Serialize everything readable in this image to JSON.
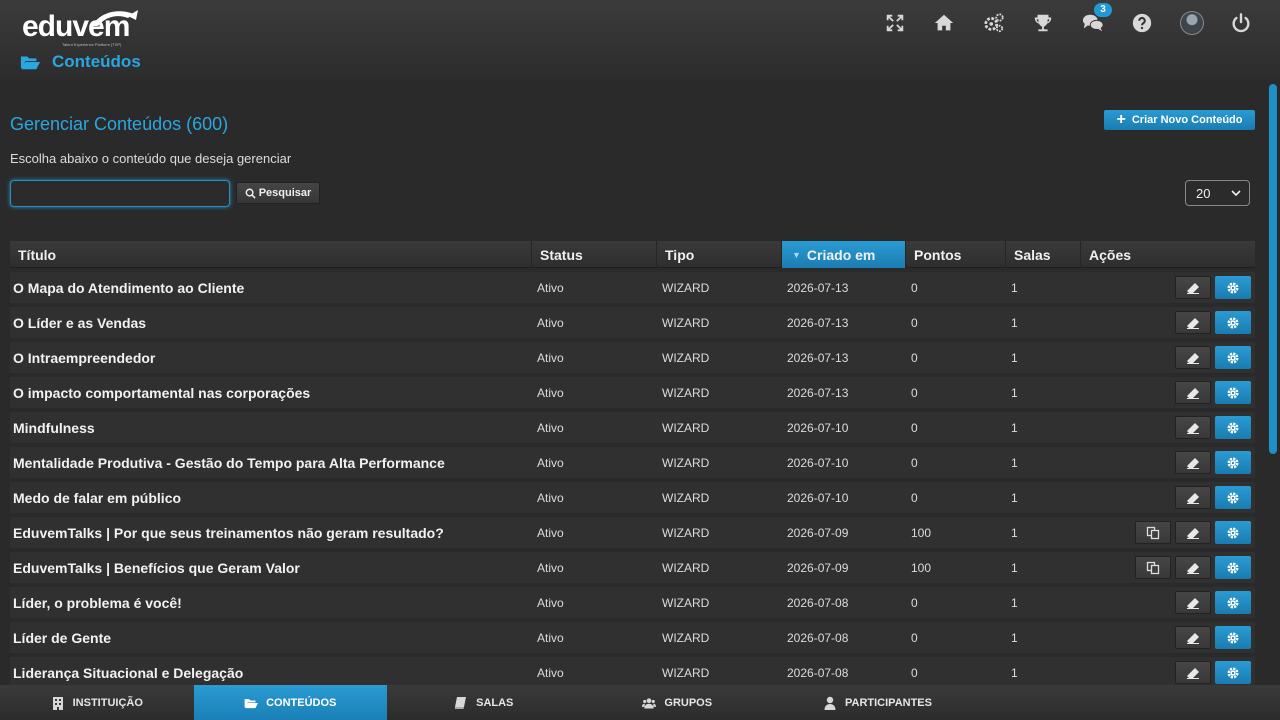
{
  "header": {
    "logo_text": "eduvem",
    "logo_tagline": "Talent Experience Platform (TXP)",
    "notification_count": "3",
    "icons": [
      "fullscreen-icon",
      "home-icon",
      "settings-icon",
      "trophy-icon",
      "chat-icon",
      "help-icon",
      "avatar",
      "power-icon"
    ]
  },
  "breadcrumb": {
    "label": "Conteúdos"
  },
  "main": {
    "title": "Gerenciar Conteúdos (600)",
    "create_label": "Criar Novo Conteúdo",
    "subtitle": "Escolha abaixo o conteúdo que deseja gerenciar",
    "search": {
      "value": "",
      "placeholder": "",
      "button_label": "Pesquisar"
    },
    "page_size": "20"
  },
  "table": {
    "headers": {
      "titulo": "Título",
      "status": "Status",
      "tipo": "Tipo",
      "criado": "Criado em",
      "pontos": "Pontos",
      "salas": "Salas",
      "acoes": "Ações"
    },
    "rows": [
      {
        "title": "O Mapa do Atendimento ao Cliente",
        "status": "Ativo",
        "type": "WIZARD",
        "created": "2026-07-13",
        "points": "0",
        "rooms": "1",
        "copy": false
      },
      {
        "title": "O Líder e as Vendas",
        "status": "Ativo",
        "type": "WIZARD",
        "created": "2026-07-13",
        "points": "0",
        "rooms": "1",
        "copy": false
      },
      {
        "title": "O Intraempreendedor",
        "status": "Ativo",
        "type": "WIZARD",
        "created": "2026-07-13",
        "points": "0",
        "rooms": "1",
        "copy": false
      },
      {
        "title": "O impacto comportamental nas corporações",
        "status": "Ativo",
        "type": "WIZARD",
        "created": "2026-07-13",
        "points": "0",
        "rooms": "1",
        "copy": false
      },
      {
        "title": "Mindfulness",
        "status": "Ativo",
        "type": "WIZARD",
        "created": "2026-07-10",
        "points": "0",
        "rooms": "1",
        "copy": false
      },
      {
        "title": "Mentalidade Produtiva - Gestão do Tempo para Alta Performance",
        "status": "Ativo",
        "type": "WIZARD",
        "created": "2026-07-10",
        "points": "0",
        "rooms": "1",
        "copy": false
      },
      {
        "title": "Medo de falar em público",
        "status": "Ativo",
        "type": "WIZARD",
        "created": "2026-07-10",
        "points": "0",
        "rooms": "1",
        "copy": false
      },
      {
        "title": "EduvemTalks | Por que seus treinamentos não geram resultado?",
        "status": "Ativo",
        "type": "WIZARD",
        "created": "2026-07-09",
        "points": "100",
        "rooms": "1",
        "copy": true
      },
      {
        "title": "EduvemTalks | Benefícios que Geram Valor",
        "status": "Ativo",
        "type": "WIZARD",
        "created": "2026-07-09",
        "points": "100",
        "rooms": "1",
        "copy": true
      },
      {
        "title": "Líder, o problema é você!",
        "status": "Ativo",
        "type": "WIZARD",
        "created": "2026-07-08",
        "points": "0",
        "rooms": "1",
        "copy": false
      },
      {
        "title": "Líder de Gente",
        "status": "Ativo",
        "type": "WIZARD",
        "created": "2026-07-08",
        "points": "0",
        "rooms": "1",
        "copy": false
      },
      {
        "title": "Liderança Situacional e Delegação",
        "status": "Ativo",
        "type": "WIZARD",
        "created": "2026-07-08",
        "points": "0",
        "rooms": "1",
        "copy": false
      }
    ]
  },
  "bottom_nav": [
    {
      "label": "INSTITUIÇÃO",
      "icon": "building-icon",
      "active": false
    },
    {
      "label": "CONTEÚDOS",
      "icon": "folder-open-icon",
      "active": true
    },
    {
      "label": "SALAS",
      "icon": "book-icon",
      "active": false
    },
    {
      "label": "GRUPOS",
      "icon": "users-icon",
      "active": false
    },
    {
      "label": "PARTICIPANTES",
      "icon": "user-icon",
      "active": false
    }
  ],
  "colors": {
    "accent": "#2aa7e0",
    "button_blue": "#1f8fc8",
    "background": "#2a2a2a"
  }
}
